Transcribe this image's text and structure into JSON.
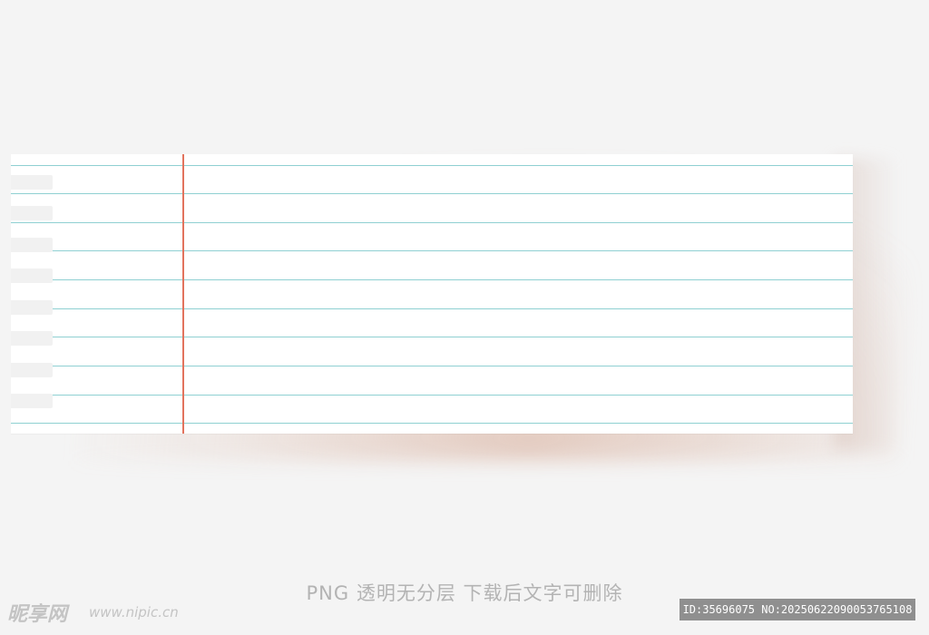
{
  "caption": "PNG 透明无分层 下载后文字可删除",
  "watermark": {
    "brand": "昵享网",
    "url": "www.nipic.cn",
    "id_text": "ID:35696075 NO:20250622090053765108"
  },
  "colors": {
    "background": "#f4f4f4",
    "paper": "#ffffff",
    "rule_line": "#8fd0d2",
    "margin_line": "#e2735d",
    "id_bar": "#8f8f8f"
  }
}
